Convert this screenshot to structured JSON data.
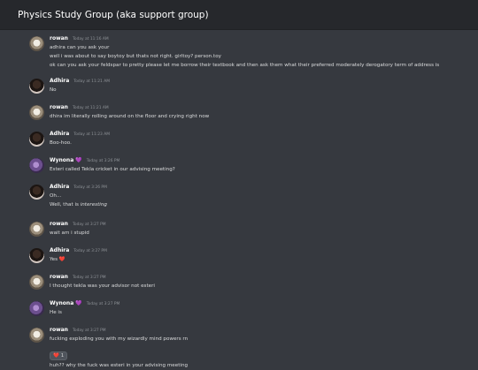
{
  "channel": {
    "title": "Physics Study Group (aka support group)"
  },
  "messages": [
    {
      "author": "rowan",
      "badge": "",
      "time": "Today at 11:16 AM",
      "lines": [
        "adhira can you ask your",
        "well i was about to say boytoy but thats not right. girltoy? person.toy",
        "ok can you ask your feldspar to pretty please let me borrow their textbook and then ask them what their preferred moderately derogatory term of address is"
      ]
    },
    {
      "author": "Adhira",
      "badge": "",
      "time": "Today at 11:21 AM",
      "lines": [
        "No"
      ]
    },
    {
      "author": "rowan",
      "badge": "",
      "time": "Today at 11:21 AM",
      "lines": [
        "dhira im literally rolling around on the floor and crying right now"
      ]
    },
    {
      "author": "Adhira",
      "badge": "",
      "time": "Today at 11:23 AM",
      "lines": [
        "Boo-hoo."
      ]
    },
    {
      "author": "Wynona",
      "badge": "💜",
      "time": "Today at 3:26 PM",
      "lines": [
        "Esteri called Tekla cricket in our advising meeting?"
      ]
    },
    {
      "author": "Adhira",
      "badge": "",
      "time": "Today at 3:26 PM",
      "lines": [
        "Oh...",
        "Well, that is",
        "interesting"
      ]
    },
    {
      "author": "rowan",
      "badge": "",
      "time": "Today at 3:27 PM",
      "lines": [
        "wait am i stupid"
      ]
    },
    {
      "author": "Adhira",
      "badge": "",
      "time": "Today at 3:27 PM",
      "lines": [
        "Yes",
        "❤️"
      ]
    },
    {
      "author": "rowan",
      "badge": "",
      "time": "Today at 3:27 PM",
      "lines": [
        "I thought tekla was your advisor not esteri"
      ]
    },
    {
      "author": "Wynona",
      "badge": "💜",
      "time": "Today at 3:27 PM",
      "lines": [
        "He is"
      ]
    },
    {
      "author": "rowan",
      "badge": "",
      "time": "Today at 3:27 PM",
      "lines": [
        "fucking exploding you with my wizardly mind powers rn",
        "huh?? why the fuck was esteri in your advising meeting"
      ],
      "reaction": {
        "emoji": "❤️",
        "count": "1"
      }
    }
  ],
  "colors": {
    "background": "#36393f",
    "titlebar": "#26282c",
    "username": "#ffffff",
    "timestamp": "#8e9297",
    "badge": "#a45ce6",
    "heart": "#dd2e44"
  },
  "icons": {
    "avatar-rowan": "avatar-icon",
    "avatar-adhira": "avatar-icon",
    "avatar-wynona": "avatar-icon",
    "badge": "purple-heart-icon",
    "heart": "red-heart-icon"
  }
}
